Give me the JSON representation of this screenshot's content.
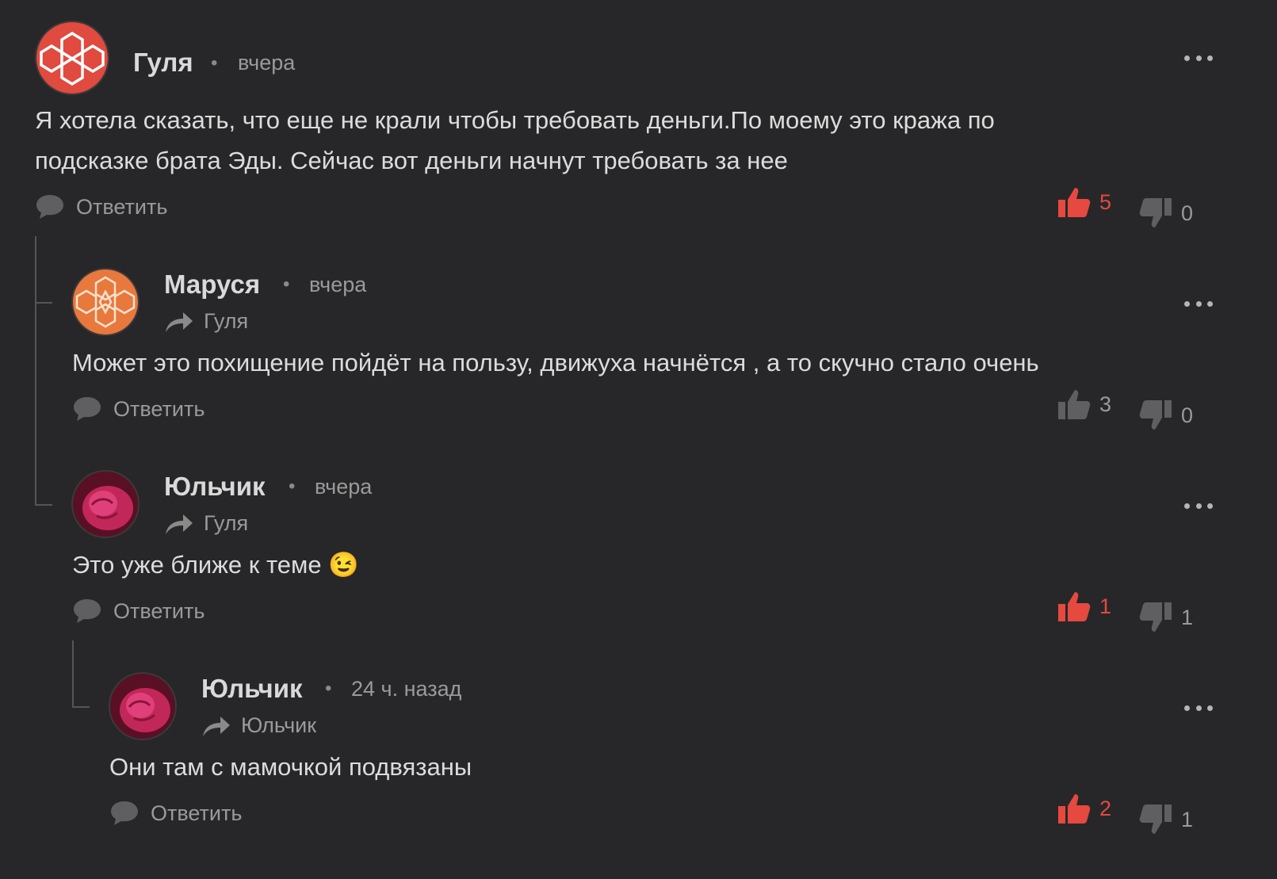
{
  "comments": [
    {
      "author": "Гуля",
      "time": "вчера",
      "reply_to": "",
      "text": [
        "Я хотела сказать, что еще не крали чтобы требовать деньги.По моему это кража по",
        "подсказке брата Эды. Сейчас вот деньги начнут требовать за нее"
      ],
      "reply_label": "Ответить",
      "likes": "5",
      "dislikes": "0",
      "liked": true
    },
    {
      "author": "Маруся",
      "time": "вчера",
      "reply_to": "Гуля",
      "text": [
        "Может это похищение пойдёт на пользу, движуха начнётся , а то скучно стало очень"
      ],
      "reply_label": "Ответить",
      "likes": "3",
      "dislikes": "0",
      "liked": false
    },
    {
      "author": "Юльчик",
      "time": "вчера",
      "reply_to": "Гуля",
      "text": [
        "Это уже ближе к теме 😉"
      ],
      "reply_label": "Ответить",
      "likes": "1",
      "dislikes": "1",
      "liked": true
    },
    {
      "author": "Юльчик",
      "time": "24 ч. назад",
      "reply_to": "Юльчик",
      "text": [
        "Они там с мамочкой подвязаны"
      ],
      "reply_label": "Ответить",
      "likes": "2",
      "dislikes": "1",
      "liked": true
    }
  ],
  "colors": {
    "background": "#272729",
    "accent": "#e5493f",
    "muted": "#9a9a9a"
  },
  "icons": {
    "reply": "speech-bubble-icon",
    "like": "thumbs-up-icon",
    "dislike": "thumbs-down-icon",
    "reply_to": "arrow-right-icon",
    "more": "more-dots-icon"
  }
}
